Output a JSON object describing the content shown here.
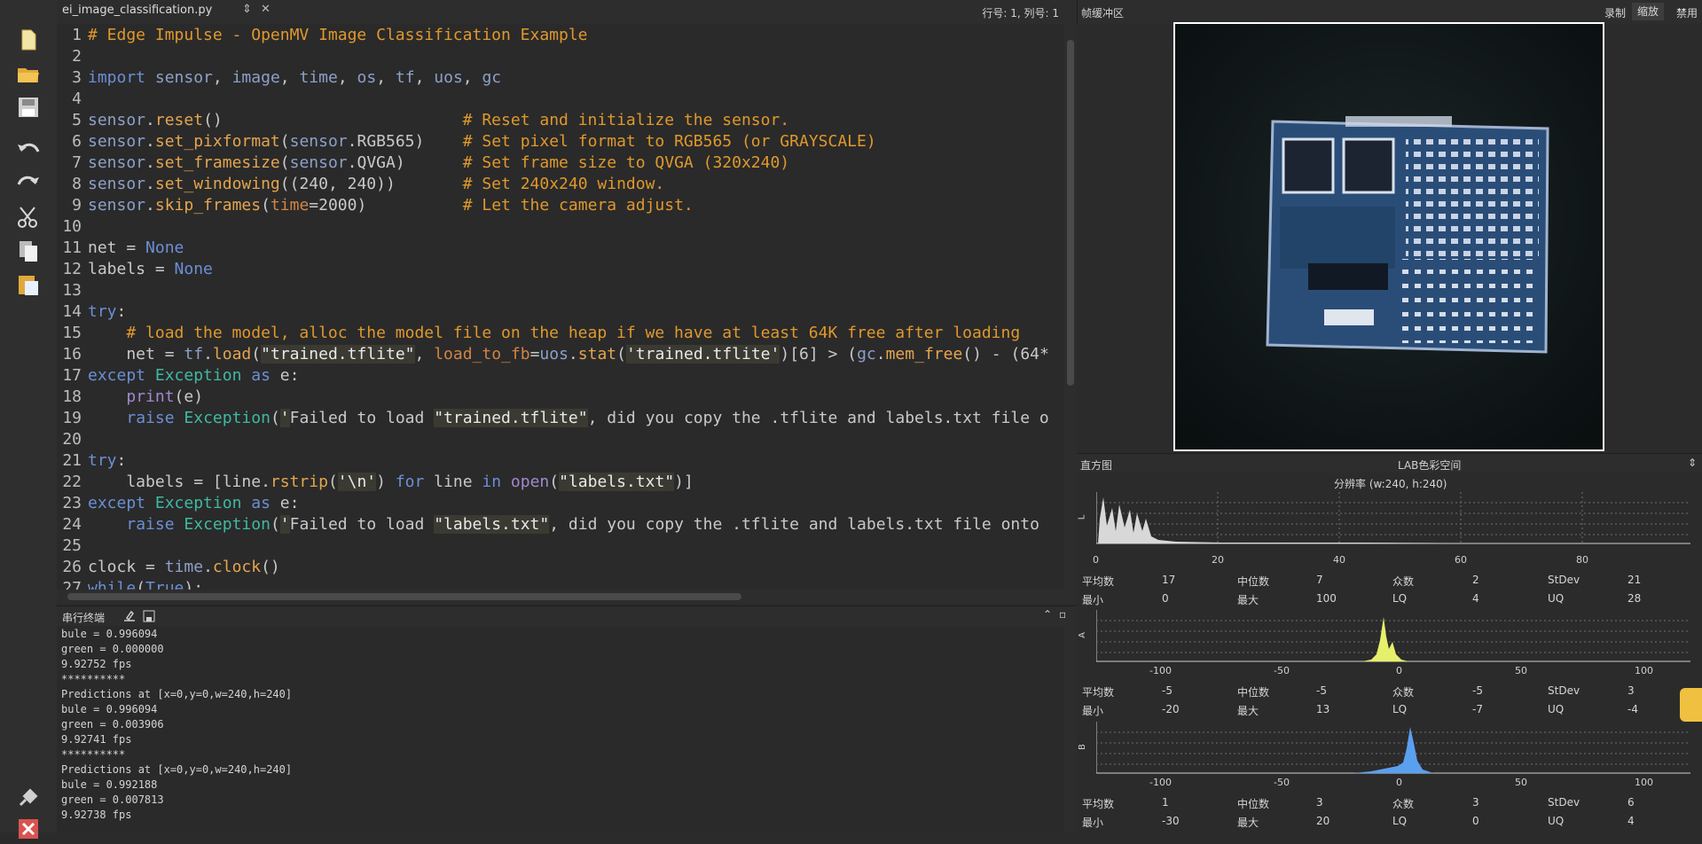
{
  "toolbar": {
    "icons": [
      "new-file-icon",
      "open-folder-icon",
      "save-icon",
      "undo-icon",
      "redo-icon",
      "cut-icon",
      "copy-icon",
      "paste-icon",
      "connect-icon",
      "stop-icon"
    ]
  },
  "editor": {
    "tab_label": "ei_image_classification.py",
    "tab_switch_glyph": "⇕",
    "tab_close_glyph": "✕",
    "cursor_position": "行号: 1, 列号: 1",
    "line_numbers": [
      "1",
      "2",
      "3",
      "4",
      "5",
      "6",
      "7",
      "8",
      "9",
      "10",
      "11",
      "12",
      "13",
      "14",
      "15",
      "16",
      "17",
      "18",
      "19",
      "20",
      "21",
      "22",
      "23",
      "24",
      "25",
      "26",
      "27"
    ],
    "lines": [
      "# Edge Impulse - OpenMV Image Classification Example",
      "",
      "import sensor, image, time, os, tf, uos, gc",
      "",
      "sensor.reset()                         # Reset and initialize the sensor.",
      "sensor.set_pixformat(sensor.RGB565)    # Set pixel format to RGB565 (or GRAYSCALE)",
      "sensor.set_framesize(sensor.QVGA)      # Set frame size to QVGA (320x240)",
      "sensor.set_windowing((240, 240))       # Set 240x240 window.",
      "sensor.skip_frames(time=2000)          # Let the camera adjust.",
      "",
      "net = None",
      "labels = None",
      "",
      "try:",
      "    # load the model, alloc the model file on the heap if we have at least 64K free after loading",
      "    net = tf.load(\"trained.tflite\", load_to_fb=uos.stat('trained.tflite')[6] > (gc.mem_free() - (64*",
      "except Exception as e:",
      "    print(e)",
      "    raise Exception('Failed to load \"trained.tflite\", did you copy the .tflite and labels.txt file o",
      "",
      "try:",
      "    labels = [line.rstrip('\\n') for line in open(\"labels.txt\")]",
      "except Exception as e:",
      "    raise Exception('Failed to load \"labels.txt\", did you copy the .tflite and labels.txt file onto",
      "",
      "clock = time.clock()",
      "while(True):"
    ]
  },
  "terminal": {
    "title": "串行终端",
    "lines": [
      "bule = 0.996094",
      "green = 0.000000",
      "9.92752 fps",
      "**********",
      "Predictions at [x=0,y=0,w=240,h=240]",
      "bule = 0.996094",
      "green = 0.003906",
      "9.92741 fps",
      "**********",
      "Predictions at [x=0,y=0,w=240,h=240]",
      "bule = 0.992188",
      "green = 0.007813",
      "9.92738 fps"
    ]
  },
  "framebuffer": {
    "title": "帧缓冲区",
    "record_label": "录制",
    "zoom_label": "缩放",
    "disable_label": "禁用"
  },
  "histogram": {
    "title": "直方图",
    "color_space": "LAB色彩空间",
    "resolution": "分辨率 (w:240, h:240)",
    "stat_labels": {
      "mean": "平均数",
      "median": "中位数",
      "mode": "众数",
      "stdev": "StDev",
      "min": "最小",
      "max": "最大",
      "lq": "LQ",
      "uq": "UQ"
    },
    "channels": [
      {
        "name": "L",
        "color": "#d8d8d8",
        "ticks": [
          "0",
          "20",
          "40",
          "60",
          "80"
        ],
        "mean": "17",
        "median": "7",
        "mode": "2",
        "stdev": "21",
        "min": "0",
        "max": "100",
        "lq": "4",
        "uq": "28"
      },
      {
        "name": "A",
        "color": "#e6f06a",
        "ticks": [
          "-100",
          "-50",
          "0",
          "50",
          "100"
        ],
        "mean": "-5",
        "median": "-5",
        "mode": "-5",
        "stdev": "3",
        "min": "-20",
        "max": "13",
        "lq": "-7",
        "uq": "-4"
      },
      {
        "name": "B",
        "color": "#5aa0f0",
        "ticks": [
          "-100",
          "-50",
          "0",
          "50",
          "100"
        ],
        "mean": "1",
        "median": "3",
        "mode": "3",
        "stdev": "6",
        "min": "-30",
        "max": "20",
        "lq": "0",
        "uq": "4"
      }
    ]
  }
}
